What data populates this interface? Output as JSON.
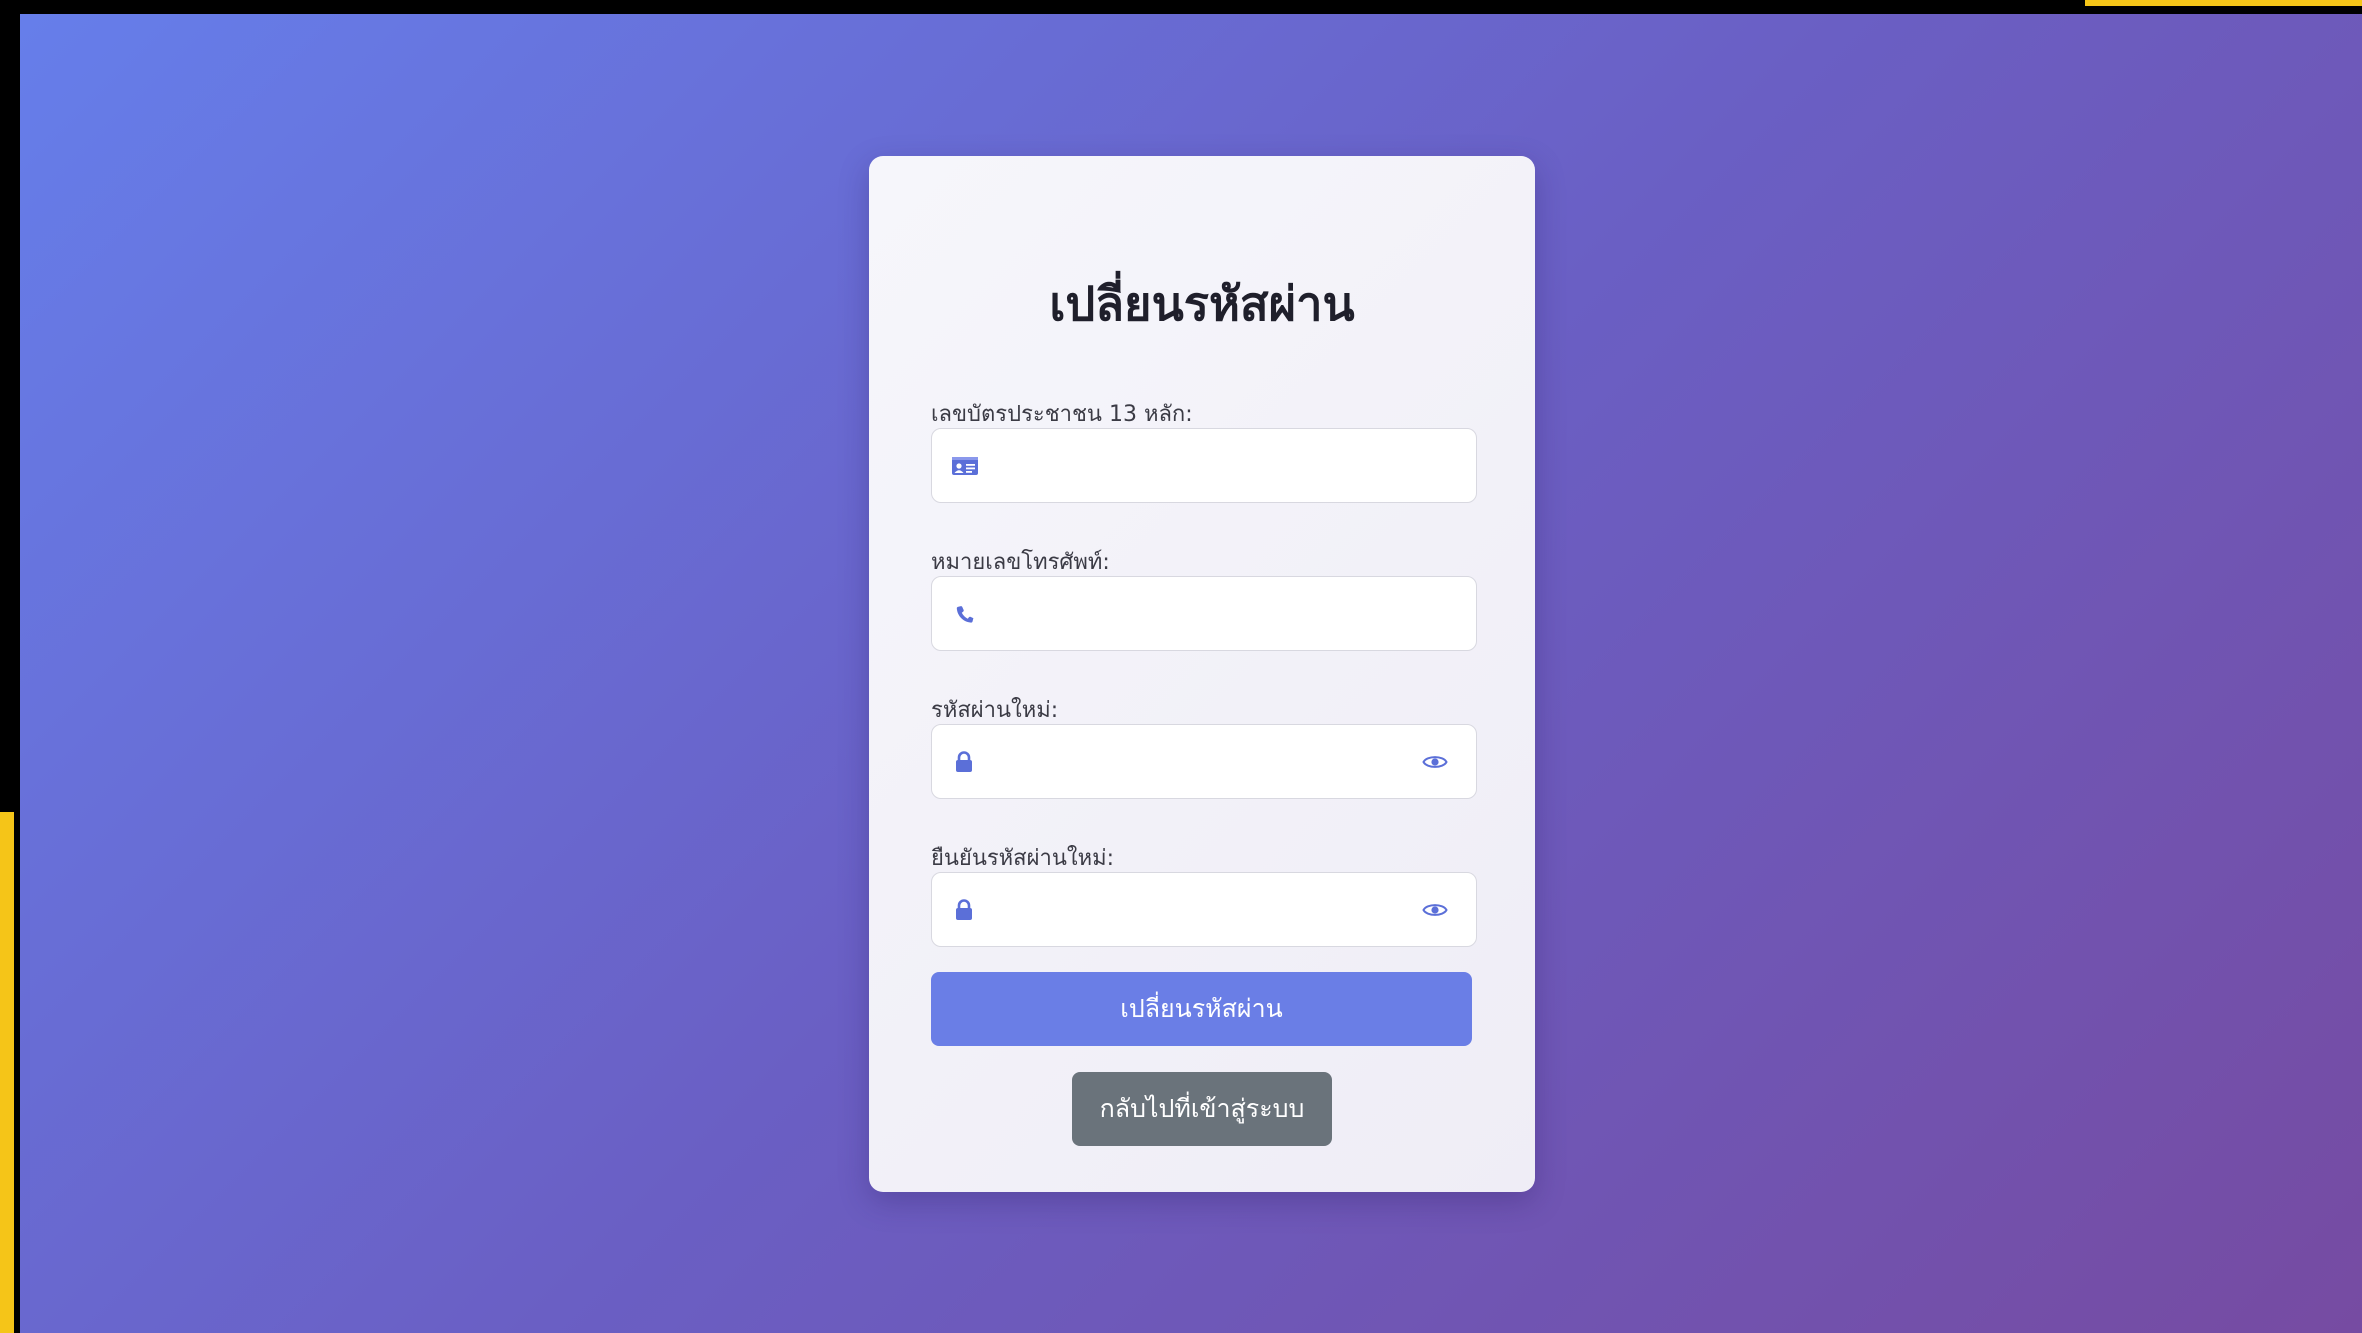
{
  "form": {
    "title": "เปลี่ยนรหัสผ่าน",
    "fields": [
      {
        "label": "เลขบัตรประชาชน 13 หลัก:",
        "value": "",
        "placeholder": "",
        "icon": "id-card-icon"
      },
      {
        "label": "หมายเลขโทรศัพท์:",
        "value": "",
        "placeholder": "",
        "icon": "phone-icon"
      },
      {
        "label": "รหัสผ่านใหม่:",
        "value": "",
        "placeholder": "",
        "icon": "lock-icon",
        "toggle_icon": "eye-icon"
      },
      {
        "label": "ยืนยันรหัสผ่านใหม่:",
        "value": "",
        "placeholder": "",
        "icon": "lock-icon",
        "toggle_icon": "eye-icon"
      }
    ],
    "submit_label": "เปลี่ยนรหัสผ่าน",
    "back_label": "กลับไปที่เข้าสู่ระบบ"
  },
  "colors": {
    "background_start": "#667eea",
    "background_end": "#764ba2",
    "primary_button": "#6a7ee6",
    "secondary_button": "#6a737b",
    "icon": "#5b6fd8",
    "frame_accent": "#f5c518"
  }
}
